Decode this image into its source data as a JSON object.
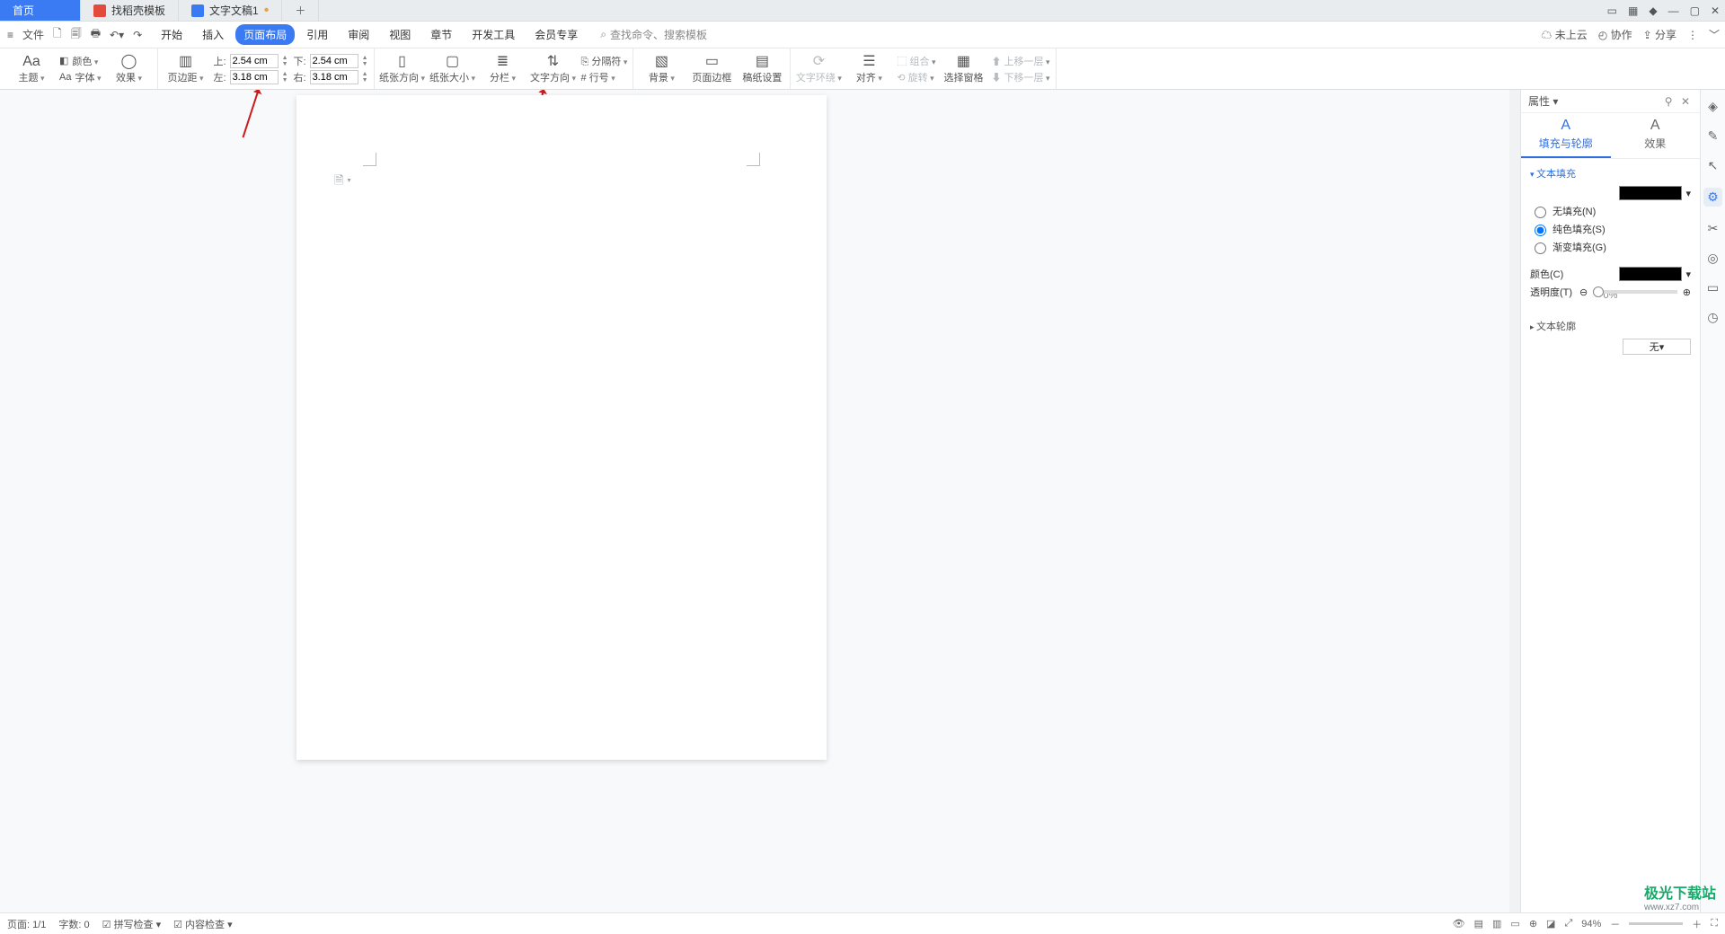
{
  "tabs": {
    "home": "首页",
    "templates": "找稻壳模板",
    "doc": "文字文稿1"
  },
  "menu": {
    "file": "文件",
    "items": [
      "开始",
      "插入",
      "页面布局",
      "引用",
      "审阅",
      "视图",
      "章节",
      "开发工具",
      "会员专享"
    ],
    "active_index": 2,
    "search_placeholder": "查找命令、搜索模板",
    "cloud": "未上云",
    "collab": "协作",
    "share": "分享"
  },
  "ribbon": {
    "theme": "主题",
    "font": "字体",
    "color": "颜色",
    "effect": "效果",
    "margins": "页边距",
    "top_lab": "上:",
    "top": "2.54 cm",
    "bottom_lab": "下:",
    "bottom": "2.54 cm",
    "left_lab": "左:",
    "left": "3.18 cm",
    "right_lab": "右:",
    "right": "3.18 cm",
    "orient": "纸张方向",
    "size": "纸张大小",
    "columns": "分栏",
    "txtdir": "文字方向",
    "breaks": "分隔符",
    "lineno": "行号",
    "bg": "背景",
    "border": "页面边框",
    "genkou": "稿纸设置",
    "wrap": "文字环绕",
    "align": "对齐",
    "group": "组合",
    "rotate": "旋转",
    "pane": "选择窗格",
    "up": "上移一层",
    "down": "下移一层"
  },
  "panel": {
    "title": "属性",
    "tab_fill": "填充与轮廓",
    "tab_fx": "效果",
    "text_fill": "文本填充",
    "no_fill": "无填充(N)",
    "solid": "纯色填充(S)",
    "gradient": "渐变填充(G)",
    "color": "颜色(C)",
    "opacity": "透明度(T)",
    "opv": "0%",
    "outline": "文本轮廓",
    "none": "无"
  },
  "status": {
    "page": "页面: 1/1",
    "words": "字数: 0",
    "spell": "拼写检查",
    "content": "内容检查",
    "zoom": "94%"
  },
  "watermark": {
    "brand": "极光下载站",
    "url": "www.xz7.com"
  }
}
